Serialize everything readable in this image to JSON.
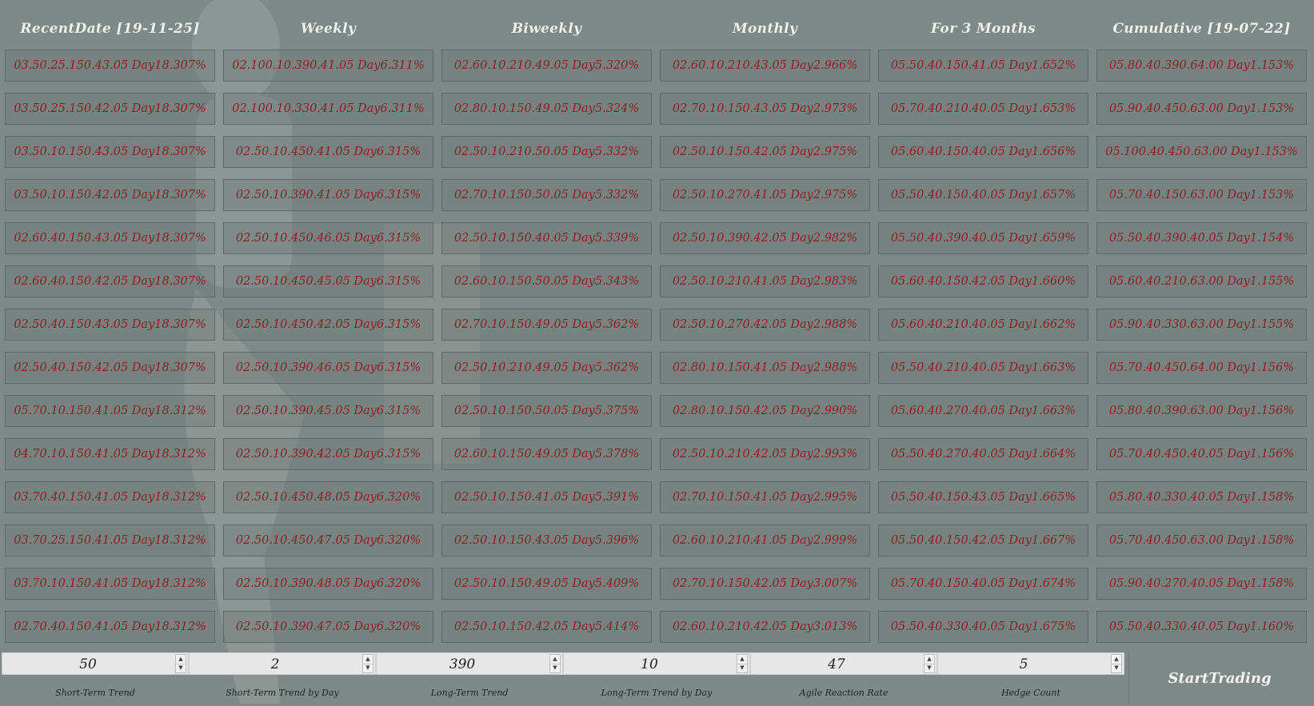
{
  "columns": [
    {
      "header": "RecentDate [19-11-25]",
      "cells": [
        "03.50.25.150.43.05 Day18.307%",
        "03.50.25.150.42.05 Day18.307%",
        "03.50.10.150.43.05 Day18.307%",
        "03.50.10.150.42.05 Day18.307%",
        "02.60.40.150.43.05 Day18.307%",
        "02.60.40.150.42.05 Day18.307%",
        "02.50.40.150.43.05 Day18.307%",
        "02.50.40.150.42.05 Day18.307%",
        "05.70.10.150.41.05 Day18.312%",
        "04.70.10.150.41.05 Day18.312%",
        "03.70.40.150.41.05 Day18.312%",
        "03.70.25.150.41.05 Day18.312%",
        "03.70.10.150.41.05 Day18.312%",
        "02.70.40.150.41.05 Day18.312%"
      ]
    },
    {
      "header": "Weekly",
      "cells": [
        "02.100.10.390.41.05 Day6.311%",
        "02.100.10.330.41.05 Day6.311%",
        "02.50.10.450.41.05 Day6.315%",
        "02.50.10.390.41.05 Day6.315%",
        "02.50.10.450.46.05 Day6.315%",
        "02.50.10.450.45.05 Day6.315%",
        "02.50.10.450.42.05 Day6.315%",
        "02.50.10.390.46.05 Day6.315%",
        "02.50.10.390.45.05 Day6.315%",
        "02.50.10.390.42.05 Day6.315%",
        "02.50.10.450.48.05 Day6.320%",
        "02.50.10.450.47.05 Day6.320%",
        "02.50.10.390.48.05 Day6.320%",
        "02.50.10.390.47.05 Day6.320%"
      ]
    },
    {
      "header": "Biweekly",
      "cells": [
        "02.60.10.210.49.05 Day5.320%",
        "02.80.10.150.49.05 Day5.324%",
        "02.50.10.210.50.05 Day5.332%",
        "02.70.10.150.50.05 Day5.332%",
        "02.50.10.150.40.05 Day5.339%",
        "02.60.10.150.50.05 Day5.343%",
        "02.70.10.150.49.05 Day5.362%",
        "02.50.10.210.49.05 Day5.362%",
        "02.50.10.150.50.05 Day5.375%",
        "02.60.10.150.49.05 Day5.378%",
        "02.50.10.150.41.05 Day5.391%",
        "02.50.10.150.43.05 Day5.396%",
        "02.50.10.150.49.05 Day5.409%",
        "02.50.10.150.42.05 Day5.414%"
      ]
    },
    {
      "header": "Monthly",
      "cells": [
        "02.60.10.210.43.05 Day2.966%",
        "02.70.10.150.43.05 Day2.973%",
        "02.50.10.150.42.05 Day2.975%",
        "02.50.10.270.41.05 Day2.975%",
        "02.50.10.390.42.05 Day2.982%",
        "02.50.10.210.41.05 Day2.983%",
        "02.50.10.270.42.05 Day2.988%",
        "02.80.10.150.41.05 Day2.988%",
        "02.80.10.150.42.05 Day2.990%",
        "02.50.10.210.42.05 Day2.993%",
        "02.70.10.150.41.05 Day2.995%",
        "02.60.10.210.41.05 Day2.999%",
        "02.70.10.150.42.05 Day3.007%",
        "02.60.10.210.42.05 Day3.013%"
      ]
    },
    {
      "header": "For 3 Months",
      "cells": [
        "05.50.40.150.41.05 Day1.652%",
        "05.70.40.210.40.05 Day1.653%",
        "05.60.40.150.40.05 Day1.656%",
        "05.50.40.150.40.05 Day1.657%",
        "05.50.40.390.40.05 Day1.659%",
        "05.60.40.150.42.05 Day1.660%",
        "05.60.40.210.40.05 Day1.662%",
        "05.50.40.210.40.05 Day1.663%",
        "05.60.40.270.40.05 Day1.663%",
        "05.50.40.270.40.05 Day1.664%",
        "05.50.40.150.43.05 Day1.665%",
        "05.50.40.150.42.05 Day1.667%",
        "05.70.40.150.40.05 Day1.674%",
        "05.50.40.330.40.05 Day1.675%"
      ]
    },
    {
      "header": "Cumulative [19-07-22]",
      "cells": [
        "05.80.40.390.64.00 Day1.153%",
        "05.90.40.450.63.00 Day1.153%",
        "05.100.40.450.63.00 Day1.153%",
        "05.70.40.150.63.00 Day1.153%",
        "05.50.40.390.40.05 Day1.154%",
        "05.60.40.210.63.00 Day1.155%",
        "05.90.40.330.63.00 Day1.155%",
        "05.70.40.450.64.00 Day1.156%",
        "05.80.40.390.63.00 Day1.156%",
        "05.70.40.450.40.05 Day1.156%",
        "05.80.40.330.40.05 Day1.158%",
        "05.70.40.450.63.00 Day1.158%",
        "05.90.40.270.40.05 Day1.158%",
        "05.50.40.330.40.05 Day1.160%"
      ]
    }
  ],
  "controls": [
    {
      "value": "50",
      "label": "Short-Term Trend"
    },
    {
      "value": "2",
      "label": "Short-Term Trend by Day"
    },
    {
      "value": "390",
      "label": "Long-Term Trend"
    },
    {
      "value": "10",
      "label": "Long-Term Trend by Day"
    },
    {
      "value": "47",
      "label": "Agile Reaction Rate"
    },
    {
      "value": "5",
      "label": "Hedge Count"
    }
  ],
  "start_button": "StartTrading",
  "colors": {
    "background": "#7e8a87",
    "cell_text": "#8e1d22",
    "header_text": "#eef0ec"
  },
  "icons": {
    "spin_up": "up-arrow-icon",
    "spin_down": "down-arrow-icon"
  }
}
